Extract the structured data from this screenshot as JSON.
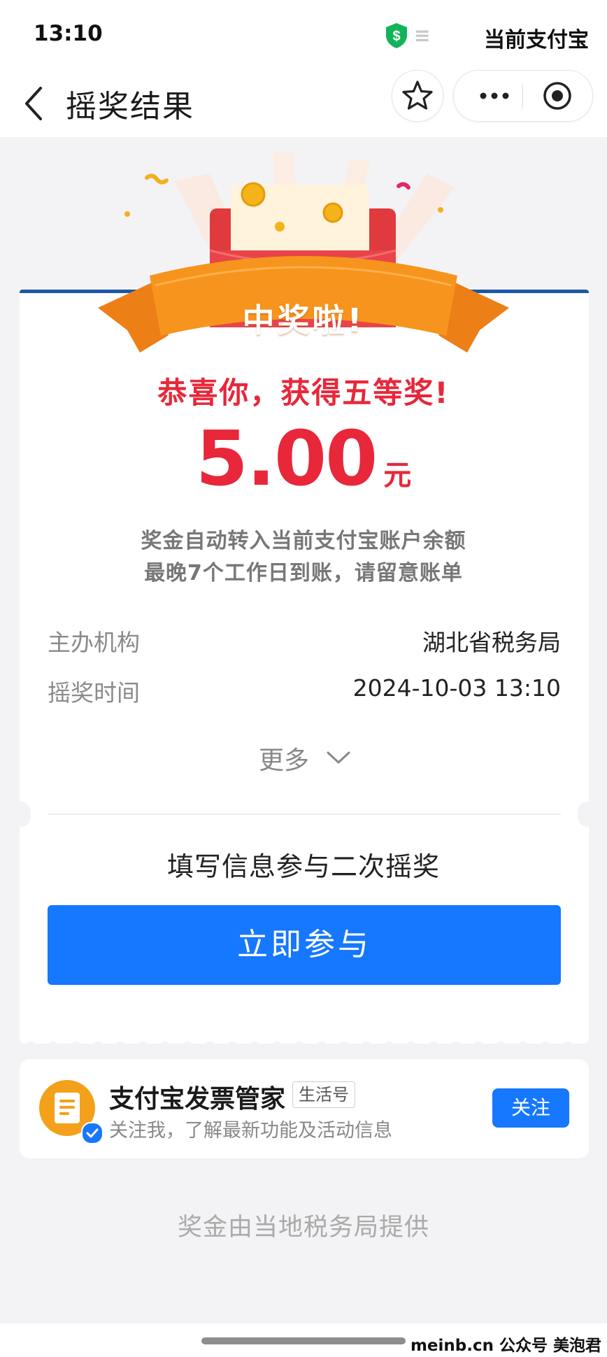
{
  "status_bar": {
    "time": "13:10",
    "right_text": "当前支付宝"
  },
  "nav": {
    "title": "摇奖结果"
  },
  "result": {
    "banner_text": "中奖啦!",
    "congrats": "恭喜你，获得五等奖!",
    "amount": "5.00",
    "unit": "元",
    "desc_line1": "奖金自动转入当前支付宝账户余额",
    "desc_line2": "最晚7个工作日到账，请留意账单",
    "rows": [
      {
        "label": "主办机构",
        "value": "湖北省税务局"
      },
      {
        "label": "摇奖时间",
        "value": "2024-10-03 13:10"
      }
    ],
    "more_label": "更多",
    "second_draw_title": "填写信息参与二次摇奖",
    "cta_label": "立即参与"
  },
  "account": {
    "name": "支付宝发票管家",
    "tag": "生活号",
    "desc": "关注我，了解最新功能及活动信息",
    "follow_label": "关注"
  },
  "footer_note": "奖金由当地税务局提供",
  "watermark": "meinb.cn  公众号 美泡君",
  "colors": {
    "accent_red": "#e8273a",
    "primary_blue": "#1677ff",
    "banner_orange": "#f7941d"
  },
  "icons": [
    "shield-dollar-icon",
    "back-arrow-icon",
    "star-icon",
    "more-dots-icon",
    "target-icon",
    "red-envelope-illustration",
    "chevron-down-icon",
    "invoice-icon",
    "verified-icon"
  ]
}
